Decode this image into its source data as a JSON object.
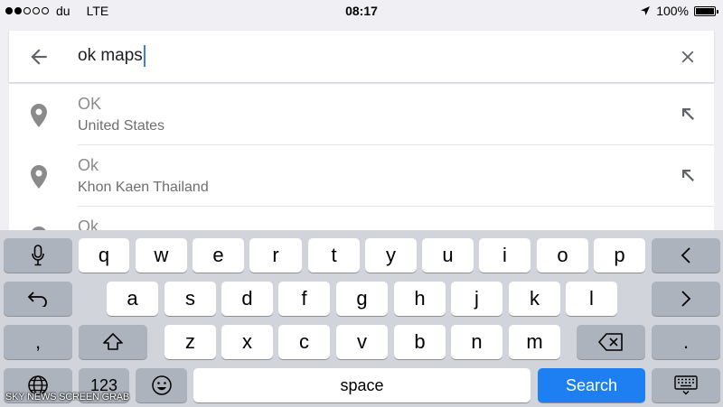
{
  "status_bar": {
    "carrier": "du",
    "network": "LTE",
    "time": "08:17",
    "battery": "100%"
  },
  "search": {
    "query": "ok maps",
    "back_icon": "arrow-left-icon",
    "clear_icon": "close-icon"
  },
  "results": [
    {
      "title": "OK",
      "subtitle": "United States"
    },
    {
      "title": "Ok",
      "subtitle": "Khon Kaen Thailand"
    },
    {
      "title": "Ok",
      "subtitle": ""
    }
  ],
  "keyboard": {
    "row1": [
      "q",
      "w",
      "e",
      "r",
      "t",
      "y",
      "u",
      "i",
      "o",
      "p"
    ],
    "row2": [
      "a",
      "s",
      "d",
      "f",
      "g",
      "h",
      "j",
      "k",
      "l"
    ],
    "row3": [
      "z",
      "x",
      "c",
      "v",
      "b",
      "n",
      "m"
    ],
    "comma": ",",
    "period": ".",
    "numbers": "123",
    "space": "space",
    "search": "Search",
    "colors": {
      "accent": "#1e7ff2",
      "key": "#ffffff",
      "special_key": "#adb3bc",
      "keyboard_bg": "#d1d5db"
    }
  },
  "watermark": "SKY NEWS SCREEN GRAB"
}
